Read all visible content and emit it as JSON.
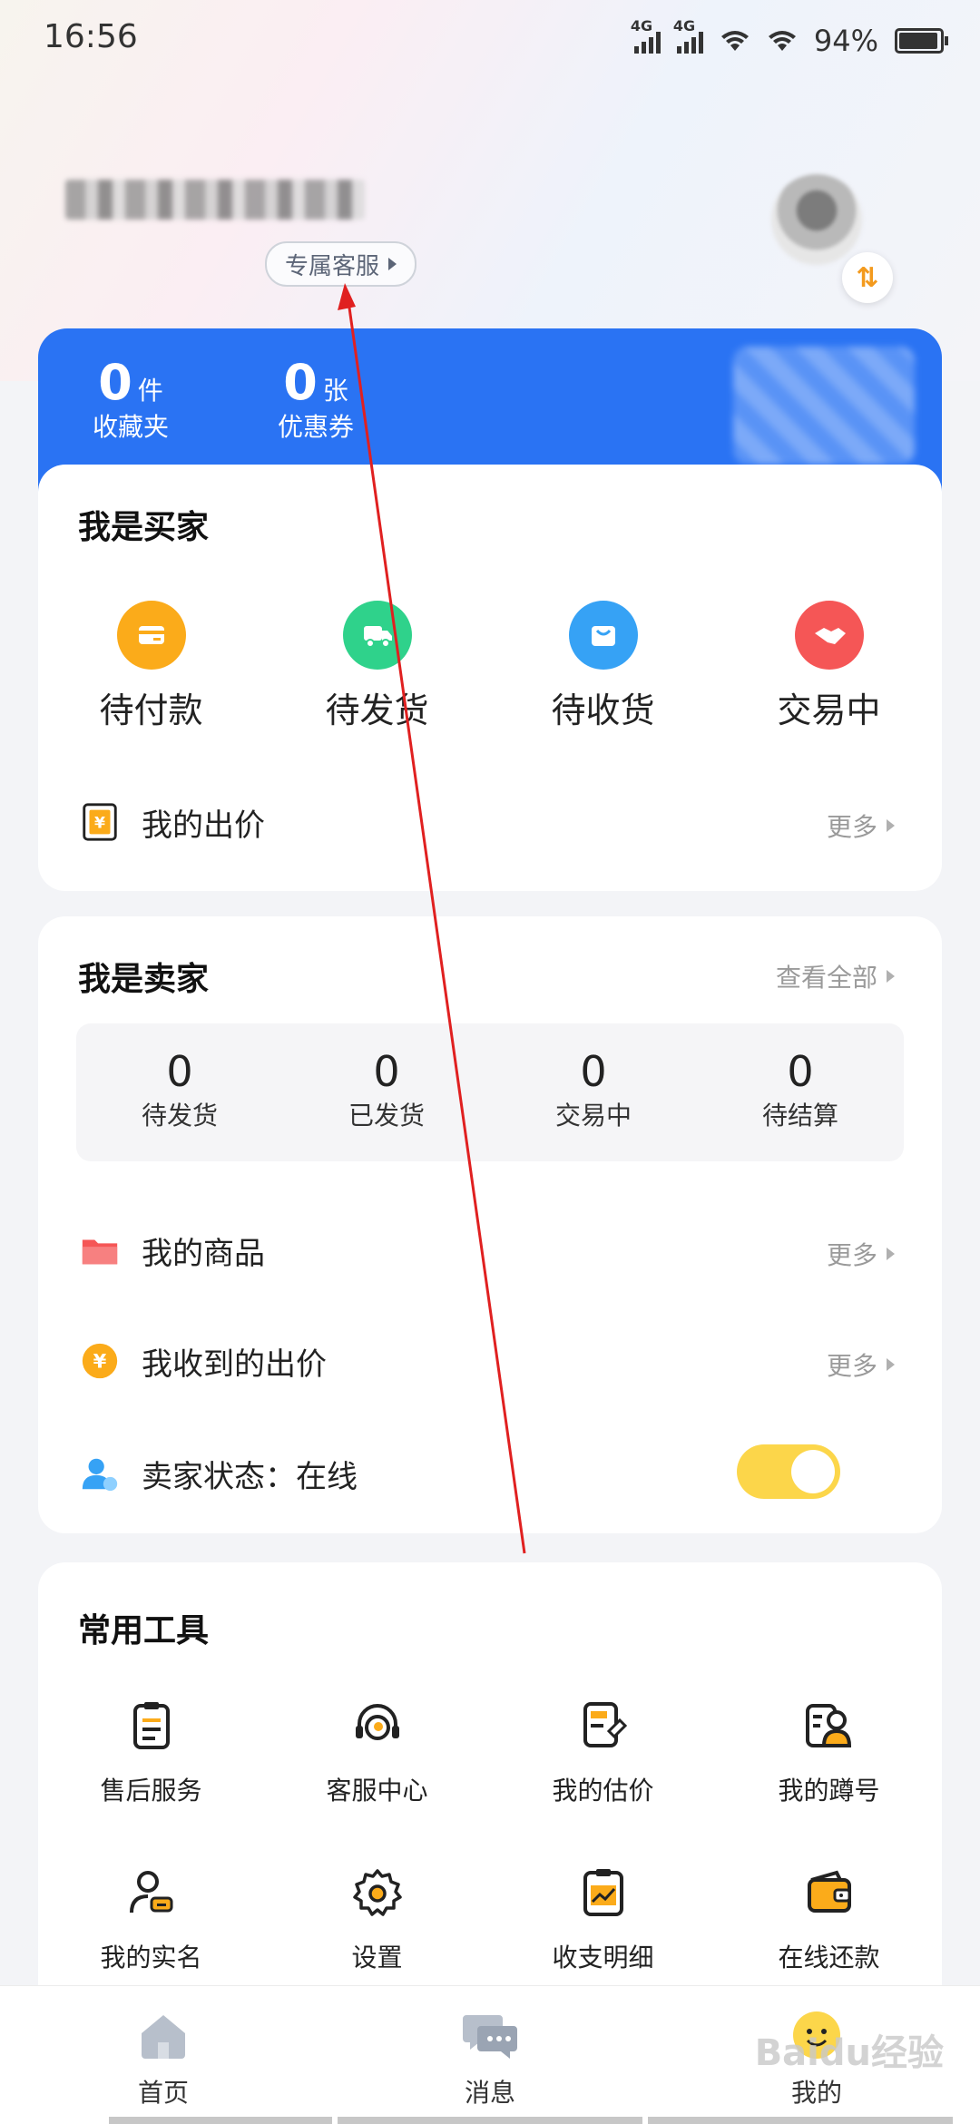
{
  "status_bar": {
    "time": "16:56",
    "network1": "4G",
    "network2": "4G",
    "battery": "94%"
  },
  "header": {
    "cs_label": "专属客服"
  },
  "stats": [
    {
      "num": "0",
      "unit": "件",
      "label": "收藏夹"
    },
    {
      "num": "0",
      "unit": "张",
      "label": "优惠券"
    }
  ],
  "buyer": {
    "title": "我是买家",
    "orders": [
      {
        "label": "待付款",
        "icon": "wallet-icon",
        "color": "#fbab1a"
      },
      {
        "label": "待发货",
        "icon": "truck-icon",
        "color": "#2fd28b"
      },
      {
        "label": "待收货",
        "icon": "bag-icon",
        "color": "#36a2f5"
      },
      {
        "label": "交易中",
        "icon": "handshake-icon",
        "color": "#f55656"
      }
    ],
    "my_bid": "我的出价",
    "more": "更多"
  },
  "seller": {
    "title": "我是卖家",
    "view_all": "查看全部",
    "stats": [
      {
        "num": "0",
        "label": "待发货"
      },
      {
        "num": "0",
        "label": "已发货"
      },
      {
        "num": "0",
        "label": "交易中"
      },
      {
        "num": "0",
        "label": "待结算"
      }
    ],
    "my_goods": "我的商品",
    "received_bids": "我收到的出价",
    "status": "卖家状态：在线",
    "more": "更多",
    "online": true
  },
  "tools": {
    "title": "常用工具",
    "items": [
      {
        "label": "售后服务",
        "icon": "clipboard-icon"
      },
      {
        "label": "客服中心",
        "icon": "headset-icon"
      },
      {
        "label": "我的估价",
        "icon": "estimate-icon"
      },
      {
        "label": "我的蹲号",
        "icon": "profile-card-icon"
      },
      {
        "label": "我的实名",
        "icon": "user-id-icon"
      },
      {
        "label": "设置",
        "icon": "gear-icon"
      },
      {
        "label": "收支明细",
        "icon": "chart-clipboard-icon"
      },
      {
        "label": "在线还款",
        "icon": "wallet-icon"
      }
    ]
  },
  "tabbar": {
    "items": [
      {
        "label": "首页",
        "icon": "home-icon"
      },
      {
        "label": "消息",
        "icon": "message-icon"
      },
      {
        "label": "我的",
        "icon": "smile-avatar-icon"
      }
    ]
  },
  "watermark": "Baidu经验",
  "colors": {
    "accent_blue": "#2a73f3",
    "toggle_on": "#fcd64a",
    "annotation_arrow": "#e02020"
  }
}
